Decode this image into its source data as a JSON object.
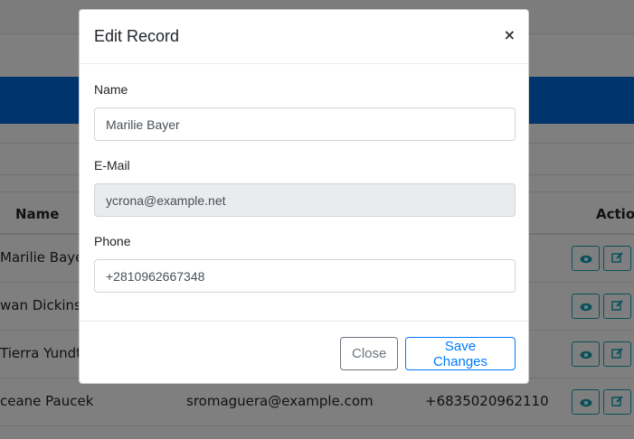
{
  "background": {
    "columns": {
      "name": "Name",
      "actions": "Action"
    },
    "rows": [
      {
        "name": "Marilie Bayer",
        "email": "",
        "phone": ""
      },
      {
        "name": "wan Dickinson",
        "email": "",
        "phone": ""
      },
      {
        "name": "Tierra Yundt",
        "email": "",
        "phone": ""
      },
      {
        "name": "ceane Paucek",
        "email": "sromaguera@example.com",
        "phone": "+6835020962110"
      }
    ]
  },
  "modal": {
    "title": "Edit Record",
    "close_symbol": "×",
    "fields": {
      "name": {
        "label": "Name",
        "value": "Marilie Bayer"
      },
      "email": {
        "label": "E-Mail",
        "value": "ycrona@example.net"
      },
      "phone": {
        "label": "Phone",
        "value": "+2810962667348"
      }
    },
    "buttons": {
      "close": "Close",
      "save": "Save Changes"
    }
  },
  "colors": {
    "primary": "#007bff",
    "info": "#17a2b8",
    "band": "#0068d9"
  },
  "icons": {
    "view": "eye-icon",
    "edit": "edit-icon"
  }
}
